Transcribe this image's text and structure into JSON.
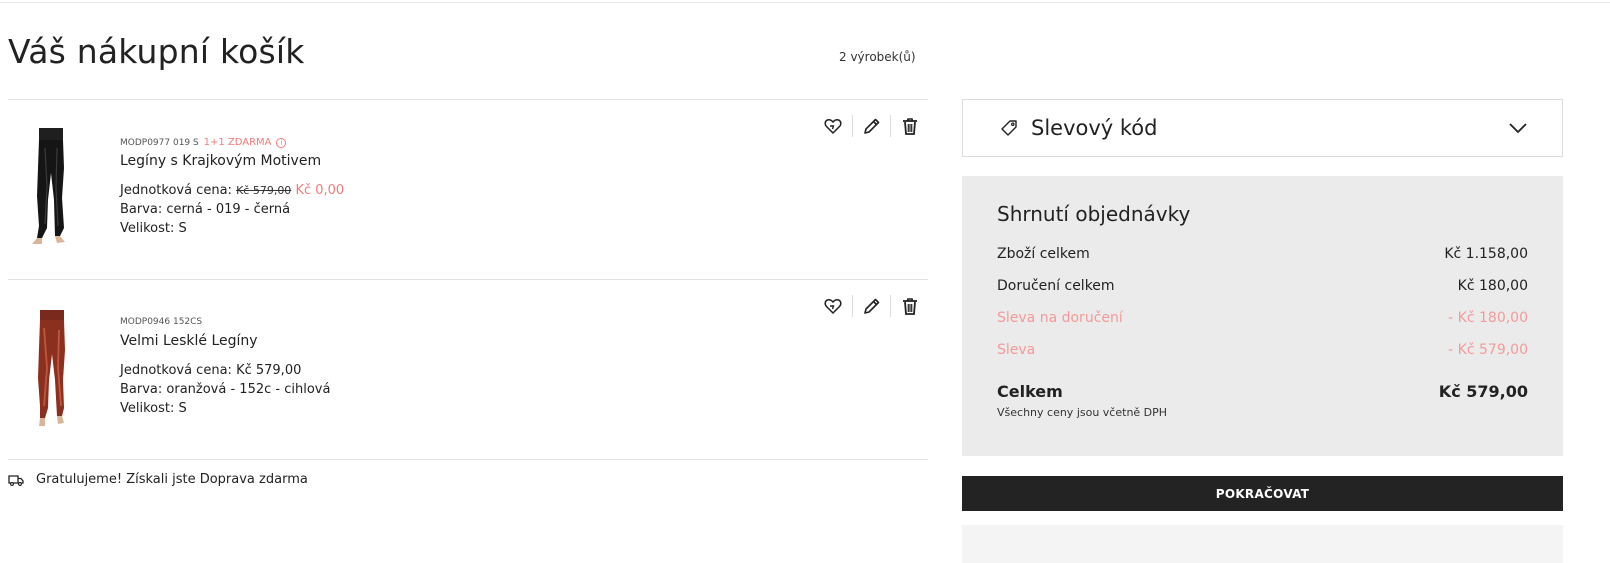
{
  "page": {
    "title": "Váš nákupní košík",
    "item_count": "2 výrobek(ů)"
  },
  "cart": {
    "items": [
      {
        "sku": "MODP0977 019 S",
        "promo": "1+1 ZDARMA",
        "promo_info": "i",
        "name": "Legíny s Krajkovým Motivem",
        "unit_price_label": "Jednotková cena:",
        "original_price": "Kč 579,00",
        "price": "Kč 0,00",
        "color": "Barva: cerná - 019 - černá",
        "size": "Velikost: S"
      },
      {
        "sku": "MODP0946 152CS",
        "name": "Velmi Lesklé Legíny",
        "unit_price_label": "Jednotková cena:",
        "price": "Kč 579,00",
        "color": "Barva: oranžová - 152c - cihlová",
        "size": "Velikost: S"
      }
    ],
    "shipping_note": "Gratulujeme! Získali jste Doprava zdarma"
  },
  "coupon": {
    "label": "Slevový kód"
  },
  "summary": {
    "title": "Shrnutí objednávky",
    "rows": [
      {
        "label": "Zboží celkem",
        "value": "Kč 1.158,00"
      },
      {
        "label": "Doručení celkem",
        "value": "Kč 180,00"
      },
      {
        "label": "Sleva na doručení",
        "value": "- Kč 180,00"
      },
      {
        "label": "Sleva",
        "value": "- Kč 579,00"
      }
    ],
    "total_label": "Celkem",
    "total_value": "Kč 579,00",
    "vat_note": "Všechny ceny jsou včetně DPH"
  },
  "actions": {
    "continue_label": "POKRAČOVAT"
  },
  "icons": {
    "wishlist": "heart-arrow-icon",
    "edit": "pencil-icon",
    "remove": "trash-icon",
    "coupon": "tag-icon",
    "chevron": "chevron-down-icon",
    "shipping": "truck-icon"
  },
  "colors": {
    "accent_sale": "#f07c7c",
    "discount": "#f49a9a",
    "button_bg": "#232323",
    "summary_bg": "#ebebeb"
  }
}
